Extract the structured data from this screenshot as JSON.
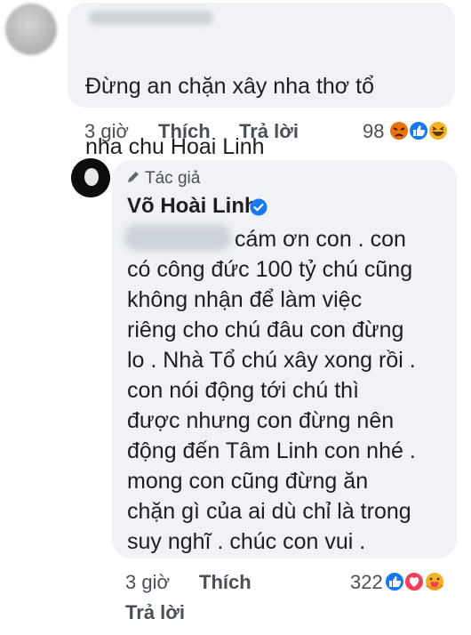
{
  "comment1": {
    "text_lines": [
      "Đừng an chặn xây nha thơ tổ",
      "nha chu Hoai Linh"
    ],
    "time": "3 giờ",
    "like_label": "Thích",
    "reply_label": "Trả lời",
    "reaction_count": "98",
    "reactions": [
      "angry-icon",
      "like-icon",
      "haha-icon"
    ]
  },
  "reply": {
    "author_badge": "Tác giả",
    "author_name": "Võ Hoài Linh",
    "verified": true,
    "text_lines": [
      "cám ơn con . con",
      "có công đức 100 tỷ chú cũng",
      "không nhận để làm việc",
      "riêng cho chú đâu con đừng",
      "lo . Nhà Tổ chú xây xong rồi .",
      "con nói động tới chú thì",
      "được nhưng con đừng nên",
      "động đến Tâm Linh con nhé .",
      "mong con cũng đừng ăn",
      "chặn gì của ai dù chỉ là trong",
      "suy nghĩ . chúc con vui ."
    ],
    "time": "3 giờ",
    "like_label": "Thích",
    "reply_label": "Trả lời",
    "reaction_count": "322",
    "reactions": [
      "like-icon",
      "love-icon",
      "care-icon"
    ]
  },
  "colors": {
    "bubble": "#f0f2f5",
    "text": "#1c1e21",
    "meta": "#4b4f56",
    "like_blue": "#1877f2",
    "love_red": "#f33e58",
    "angry_orange": "#e9710f",
    "haha_yellow": "#f7b125"
  }
}
